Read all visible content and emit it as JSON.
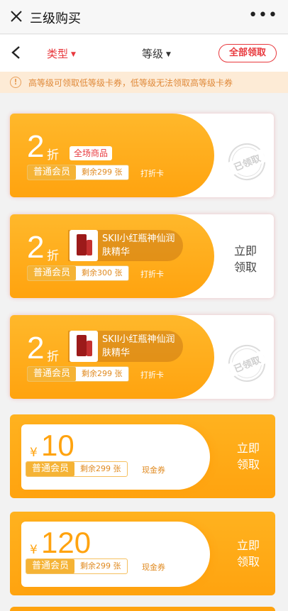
{
  "header": {
    "title": "三级购买",
    "more": "•••"
  },
  "filters": {
    "type_label": "类型",
    "level_label": "等级",
    "all_claim_label": "全部领取"
  },
  "notice": {
    "text": "高等级可领取低等级卡券，低等级无法领取高等级卡券"
  },
  "discount_coupons": [
    {
      "value": "2",
      "unit": "折",
      "scope": "全场商品",
      "product_name": "",
      "level": "普通会员",
      "remain": "剩余299 张",
      "kind": "打折卡",
      "status": "claimed",
      "stamp_text": "已领取"
    },
    {
      "value": "2",
      "unit": "折",
      "scope": "",
      "product_name": "SKII小红瓶神仙润肤精华",
      "level": "普通会员",
      "remain": "剩余300 张",
      "kind": "打折卡",
      "status": "available",
      "claim_label": "立即领取"
    },
    {
      "value": "2",
      "unit": "折",
      "scope": "",
      "product_name": "SKII小红瓶神仙润肤精华",
      "level": "普通会员",
      "remain": "剩余299 张",
      "kind": "打折卡",
      "status": "claimed",
      "stamp_text": "已领取"
    }
  ],
  "cash_coupons": [
    {
      "currency": "¥",
      "value": "10",
      "level": "普通会员",
      "remain": "剩余299 张",
      "kind": "现金券",
      "claim_label": "立即领取"
    },
    {
      "currency": "¥",
      "value": "120",
      "level": "普通会员",
      "remain": "剩余299 张",
      "kind": "现金券",
      "claim_label": "立即领取"
    }
  ],
  "colors": {
    "accent_red": "#e8383d",
    "coupon_orange": "#ffa30f",
    "notice_bg": "#fdebd6"
  }
}
